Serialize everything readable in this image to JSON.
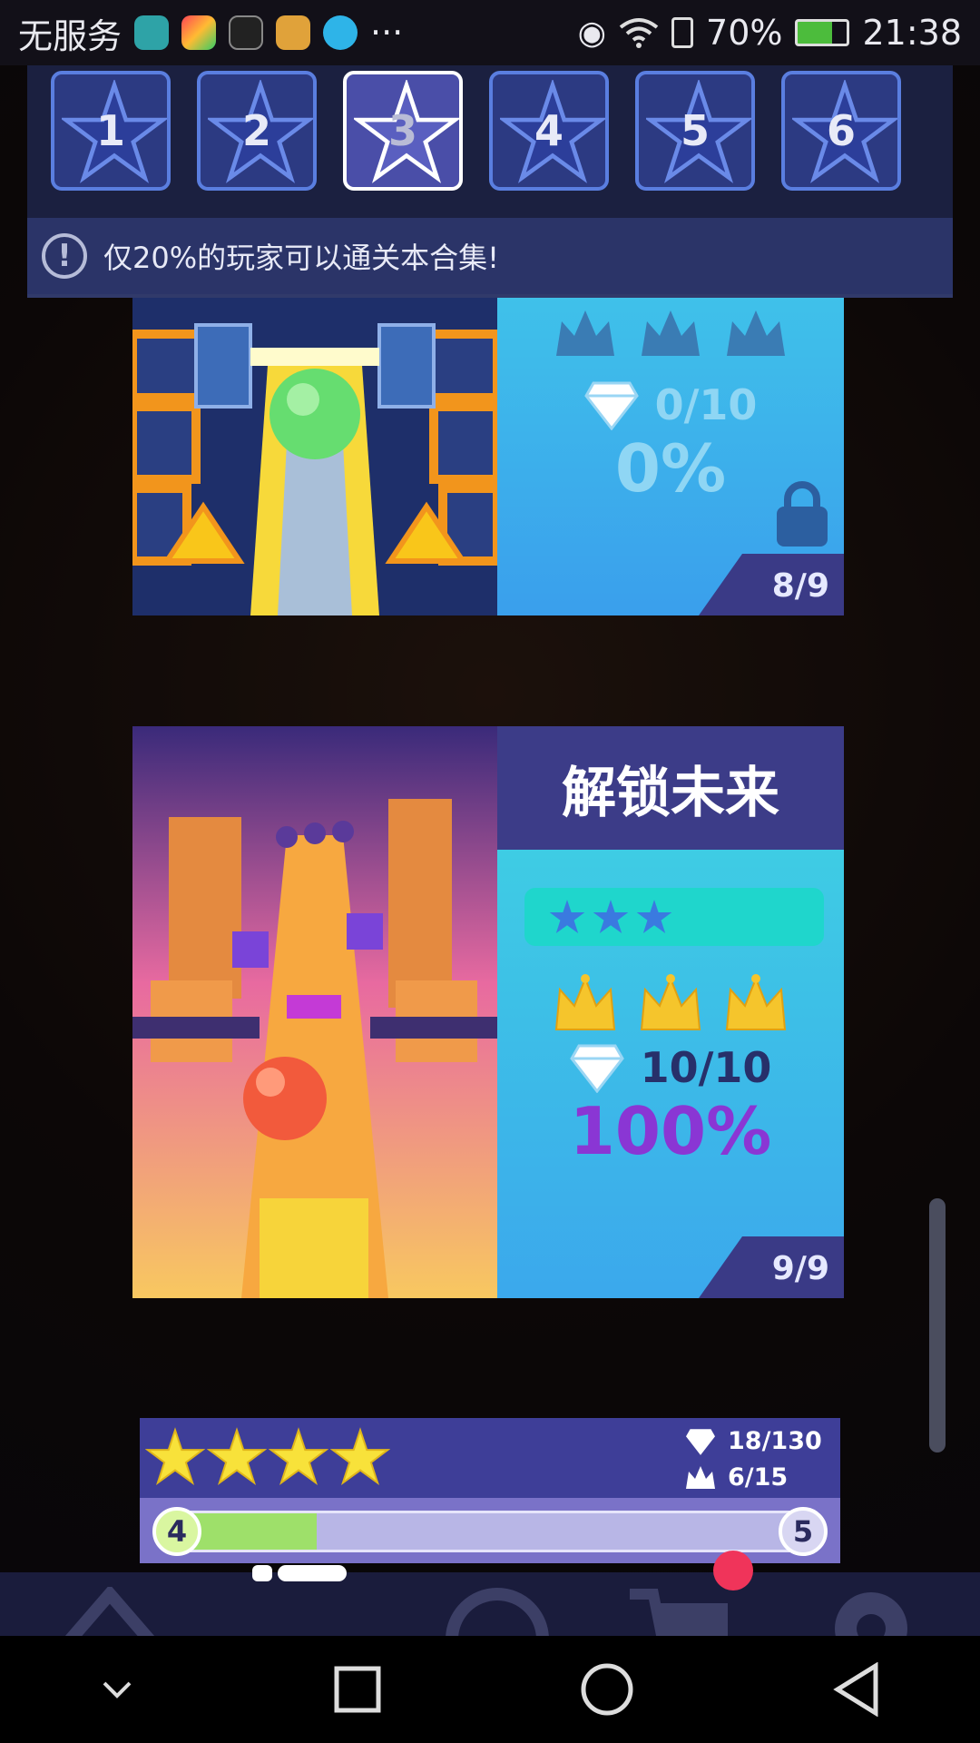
{
  "status_bar": {
    "carrier": "无服务",
    "more": "···",
    "battery": "70%",
    "time": "21:38"
  },
  "tabs": [
    {
      "label": "1",
      "active": false
    },
    {
      "label": "2",
      "active": false
    },
    {
      "label": "3",
      "active": true
    },
    {
      "label": "4",
      "active": false
    },
    {
      "label": "5",
      "active": false
    },
    {
      "label": "6",
      "active": false
    }
  ],
  "notice": {
    "text": "仅20%的玩家可以通关本合集!"
  },
  "cards": [
    {
      "gems": "0/10",
      "percent": "0%",
      "level": "8/9",
      "locked": true
    },
    {
      "title": "解锁未来",
      "stars": 3,
      "gems": "10/10",
      "percent": "100%",
      "level": "9/9"
    }
  ],
  "summary": {
    "stars": 4,
    "gems": "18/130",
    "crowns": "6/15",
    "progress_start": "4",
    "progress_end": "5",
    "progress_fraction": 0.24
  },
  "colors": {
    "accent_cyan": "#3fd6e2",
    "accent_blue": "#3aa6ee",
    "gold": "#f5c52c",
    "purple_text": "#8a36d4"
  }
}
